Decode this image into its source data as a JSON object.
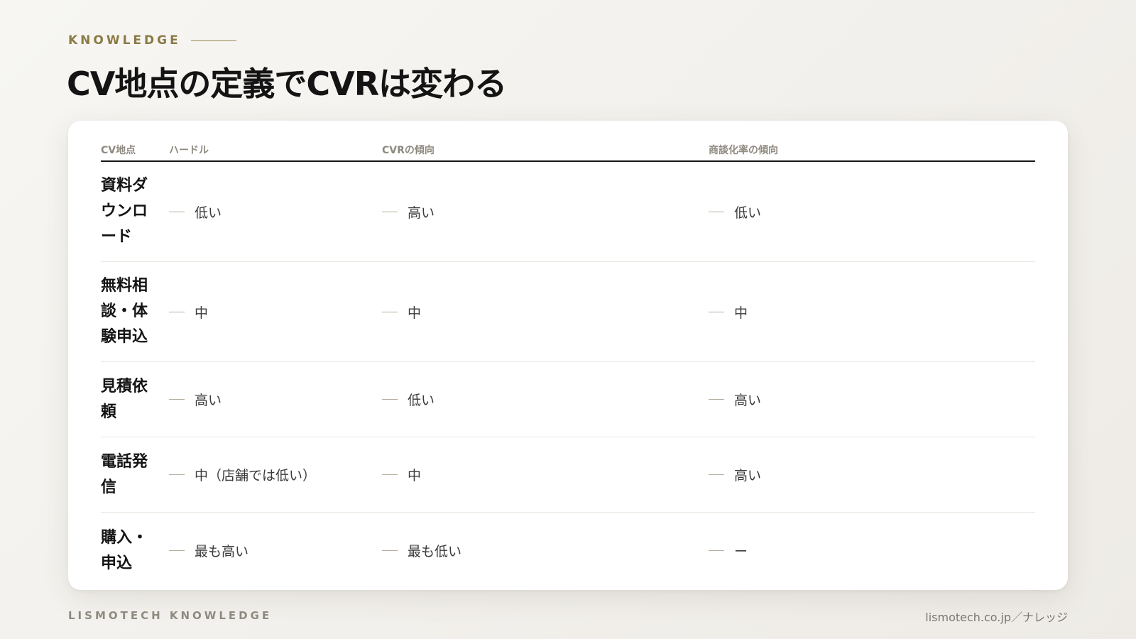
{
  "header": {
    "eyebrow": "KNOWLEDGE",
    "title": "CV地点の定義でCVRは変わる"
  },
  "table": {
    "columns": [
      "CV地点",
      "ハードル",
      "CVRの傾向",
      "商談化率の傾向"
    ],
    "rows": [
      {
        "name": "資料ダウンロード",
        "hurdle": "低い",
        "cvr": "高い",
        "deal_rate": "低い"
      },
      {
        "name": "無料相談・体験申込",
        "hurdle": "中",
        "cvr": "中",
        "deal_rate": "中"
      },
      {
        "name": "見積依頼",
        "hurdle": "高い",
        "cvr": "低い",
        "deal_rate": "高い"
      },
      {
        "name": "電話発信",
        "hurdle": "中（店舗では低い）",
        "cvr": "中",
        "deal_rate": "高い"
      },
      {
        "name": "購入・申込",
        "hurdle": "最も高い",
        "cvr": "最も低い",
        "deal_rate": "ー"
      }
    ]
  },
  "footer": {
    "brand": "LISMOTECH KNOWLEDGE",
    "url": "lismotech.co.jp／ナレッジ"
  },
  "colors": {
    "accent": "#8b7a45",
    "background": "#f3f1ed",
    "card": "#ffffff",
    "heading": "#141414",
    "muted": "#8f8a80"
  }
}
